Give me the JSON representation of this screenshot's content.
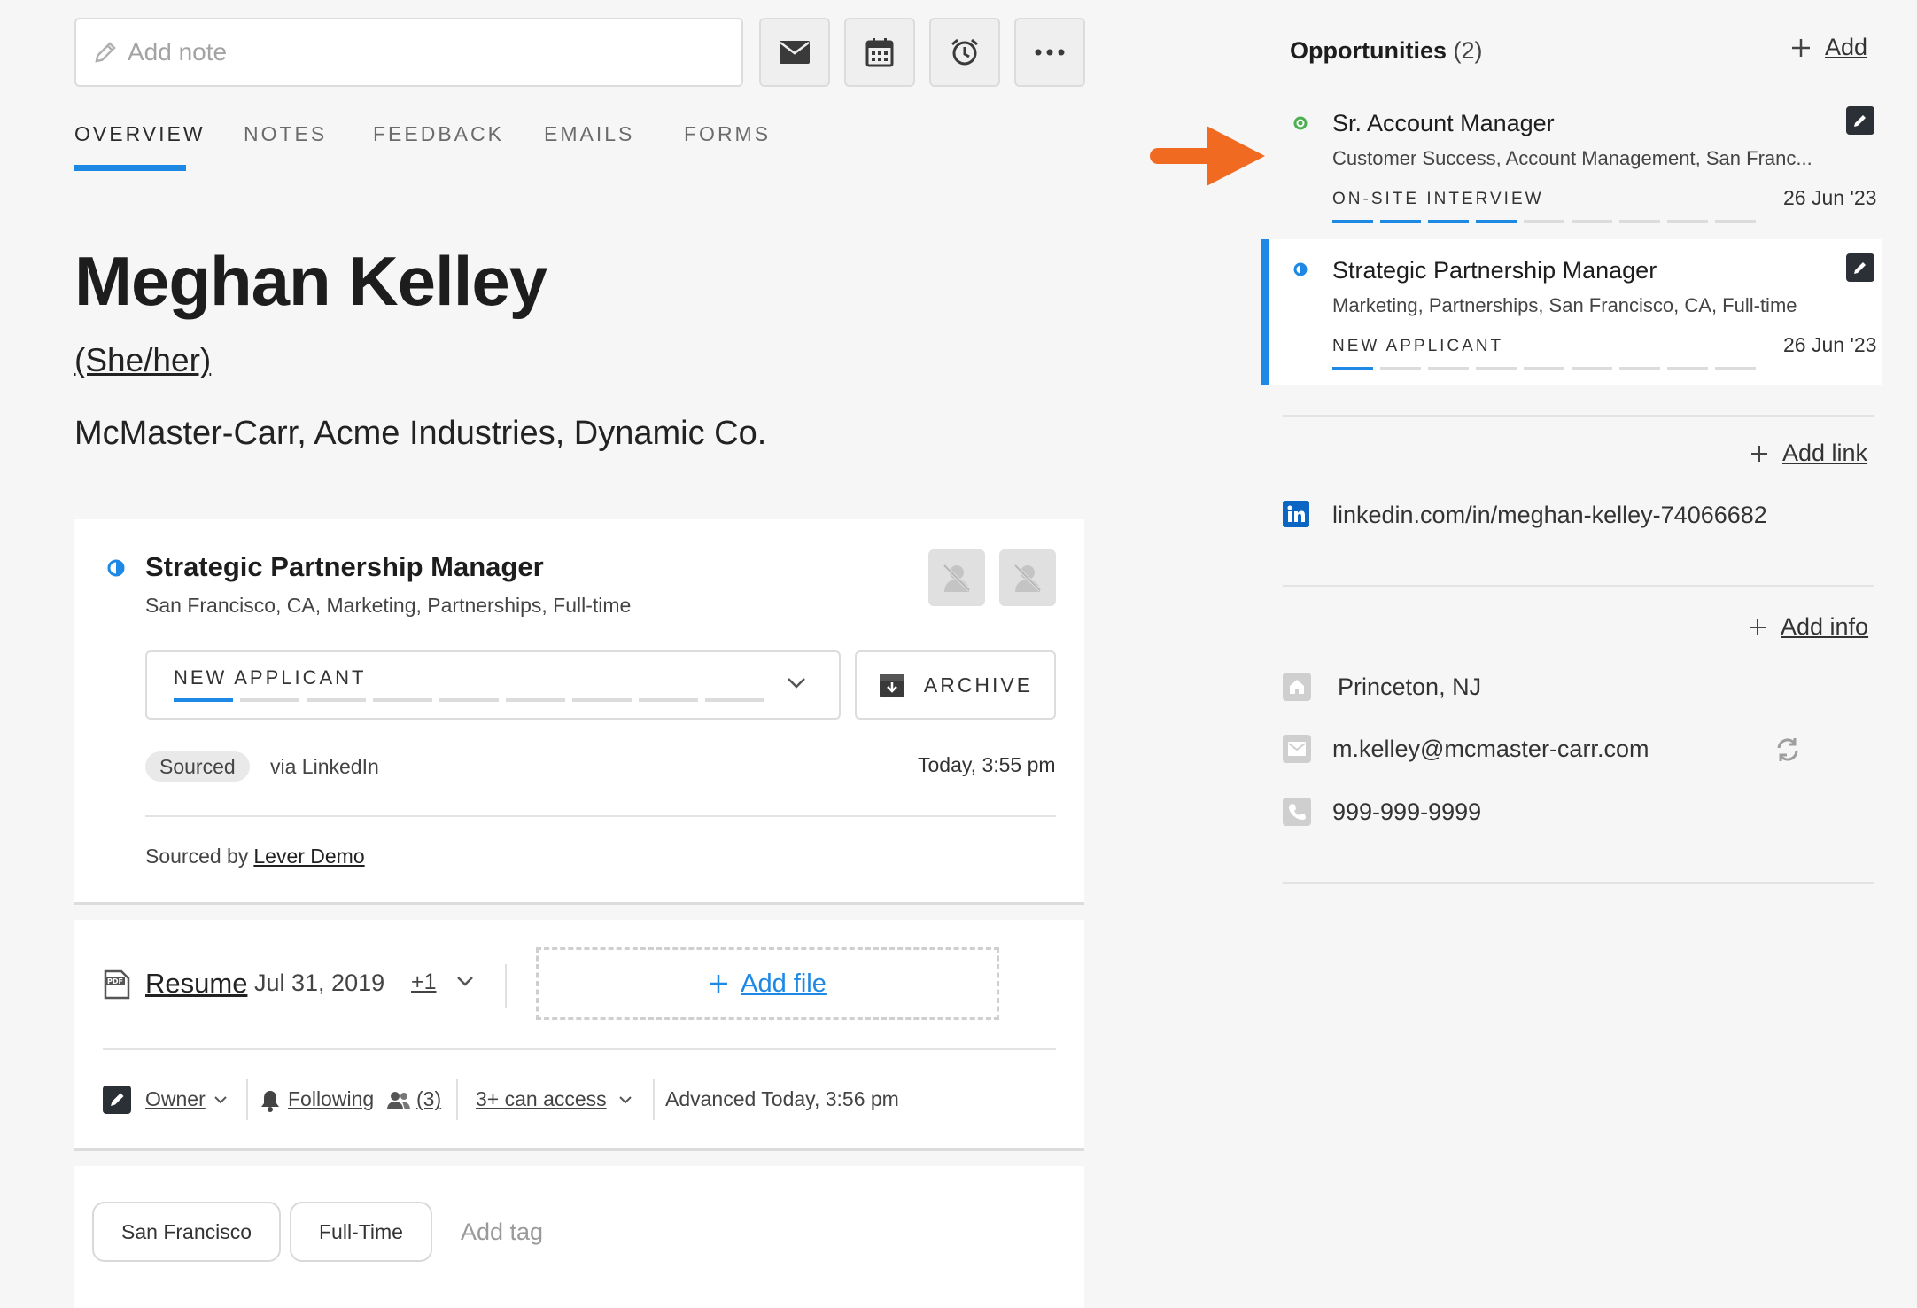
{
  "toolbar": {
    "note_placeholder": "Add note",
    "icons": [
      "pencil-icon",
      "mail-icon",
      "calendar-icon",
      "alarm-icon",
      "more-icon"
    ]
  },
  "tabs": [
    "OVERVIEW",
    "NOTES",
    "FEEDBACK",
    "EMAILS",
    "FORMS"
  ],
  "candidate": {
    "name": "Meghan Kelley",
    "pronouns": "(She/her)",
    "companies": "McMaster-Carr, Acme Industries, Dynamic Co."
  },
  "opportunity_card": {
    "title": "Strategic Partnership Manager",
    "subtitle": "San Francisco, CA, Marketing, Partnerships, Full-time",
    "stage": "NEW APPLICANT",
    "archive_label": "ARCHIVE",
    "source_badge": "Sourced",
    "source_via": "via LinkedIn",
    "timestamp": "Today, 3:55 pm",
    "sourced_by_label": "Sourced by",
    "sourced_by_name": "Lever Demo"
  },
  "files": {
    "resume_label": "Resume",
    "resume_date": "Jul 31, 2019",
    "more_count": "+1",
    "add_file_label": "Add file"
  },
  "meta": {
    "owner_label": "Owner",
    "following_label": "Following",
    "followers_count": "(3)",
    "access_label": "3+ can access",
    "advanced_text": "Advanced Today, 3:56 pm"
  },
  "tags": {
    "items": [
      "San Francisco",
      "Full-Time"
    ],
    "add_placeholder": "Add tag"
  },
  "sidebar": {
    "opportunities_title": "Opportunities",
    "opportunities_count": "(2)",
    "add_label": "Add",
    "opportunities": [
      {
        "title": "Sr. Account Manager",
        "subtitle": "Customer Success, Account Management, San Franc...",
        "stage": "ON-SITE INTERVIEW",
        "date": "26 Jun '23",
        "status_color": "#4caf50"
      },
      {
        "title": "Strategic Partnership Manager",
        "subtitle": "Marketing, Partnerships, San Francisco, CA, Full-time",
        "stage": "NEW APPLICANT",
        "date": "26 Jun '23",
        "status_color": "#1e88e5"
      }
    ],
    "add_link_label": "Add link",
    "linkedin_url": "linkedin.com/in/meghan-kelley-74066682",
    "add_info_label": "Add info",
    "location": "Princeton, NJ",
    "email": "m.kelley@mcmaster-carr.com",
    "phone": "999-999-9999"
  },
  "colors": {
    "accent": "#1e88e5",
    "arrow": "#f06a22",
    "status_green": "#4caf50"
  }
}
